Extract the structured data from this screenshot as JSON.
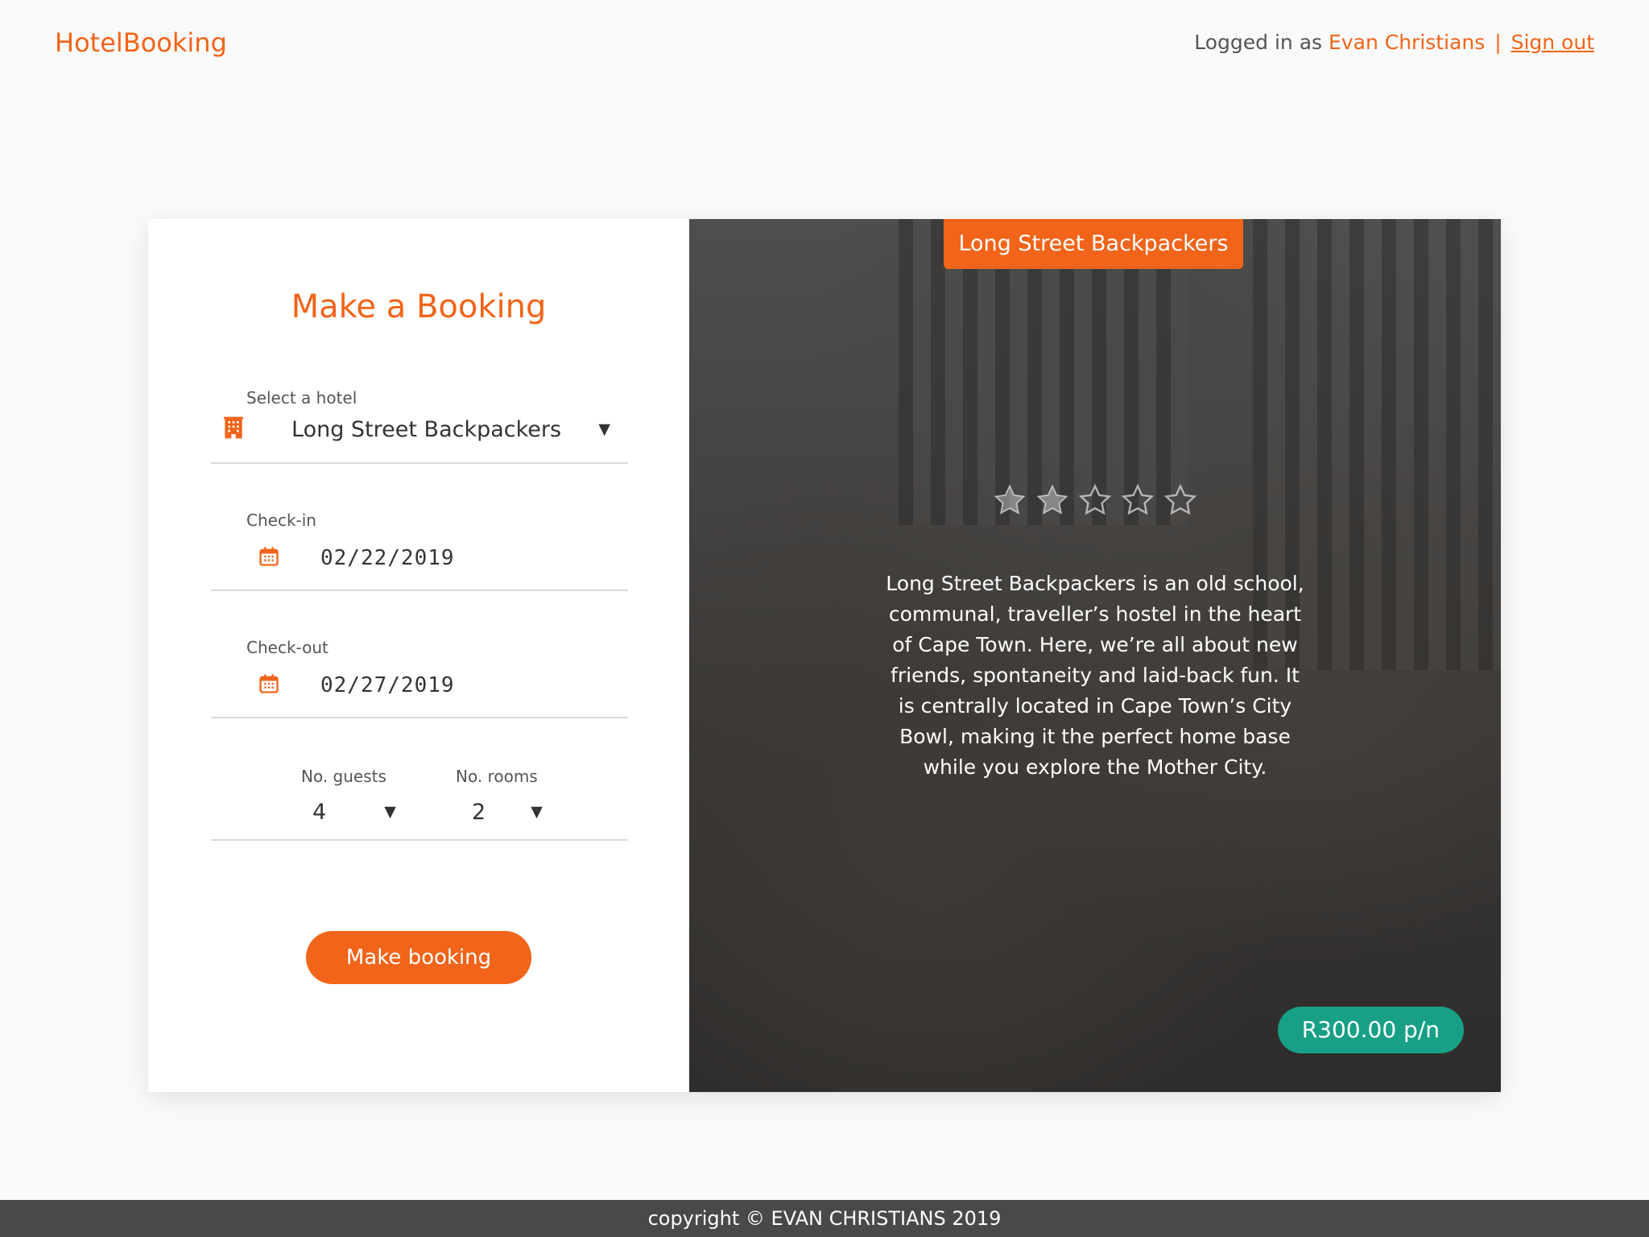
{
  "header": {
    "brand": "HotelBooking",
    "logged_in_prefix": "Logged in as",
    "user_name": "Evan Christians",
    "separator": "|",
    "sign_out": "Sign out"
  },
  "form": {
    "title": "Make a Booking",
    "hotel_label": "Select a hotel",
    "hotel_value": "Long Street Backpackers",
    "checkin_label": "Check-in",
    "checkin_value": "02/22/2019",
    "checkout_label": "Check-out",
    "checkout_value": "02/27/2019",
    "guests_label": "No. guests",
    "guests_value": "4",
    "rooms_label": "No. rooms",
    "rooms_value": "2",
    "submit_label": "Make booking"
  },
  "hotel_card": {
    "name": "Long Street Backpackers",
    "rating": 2,
    "rating_max": 5,
    "description": "Long Street Backpackers is an old school, communal, traveller’s hostel in the heart of Cape Town. Here, we’re all about new friends, spontaneity and laid-back fun. It is centrally located in Cape Town’s City Bowl, making it the perfect home base while you explore the Mother City.",
    "price": "R300.00 p/n"
  },
  "footer": {
    "text": "copyright © EVAN CHRISTIANS 2019"
  },
  "colors": {
    "accent": "#f26419",
    "price_badge": "#18a086",
    "footer_bg": "#484a47"
  },
  "icons": {
    "hotel": "hotel-icon",
    "calendar": "calendar-icon",
    "caret": "caret-down-icon",
    "star": "star-icon"
  }
}
